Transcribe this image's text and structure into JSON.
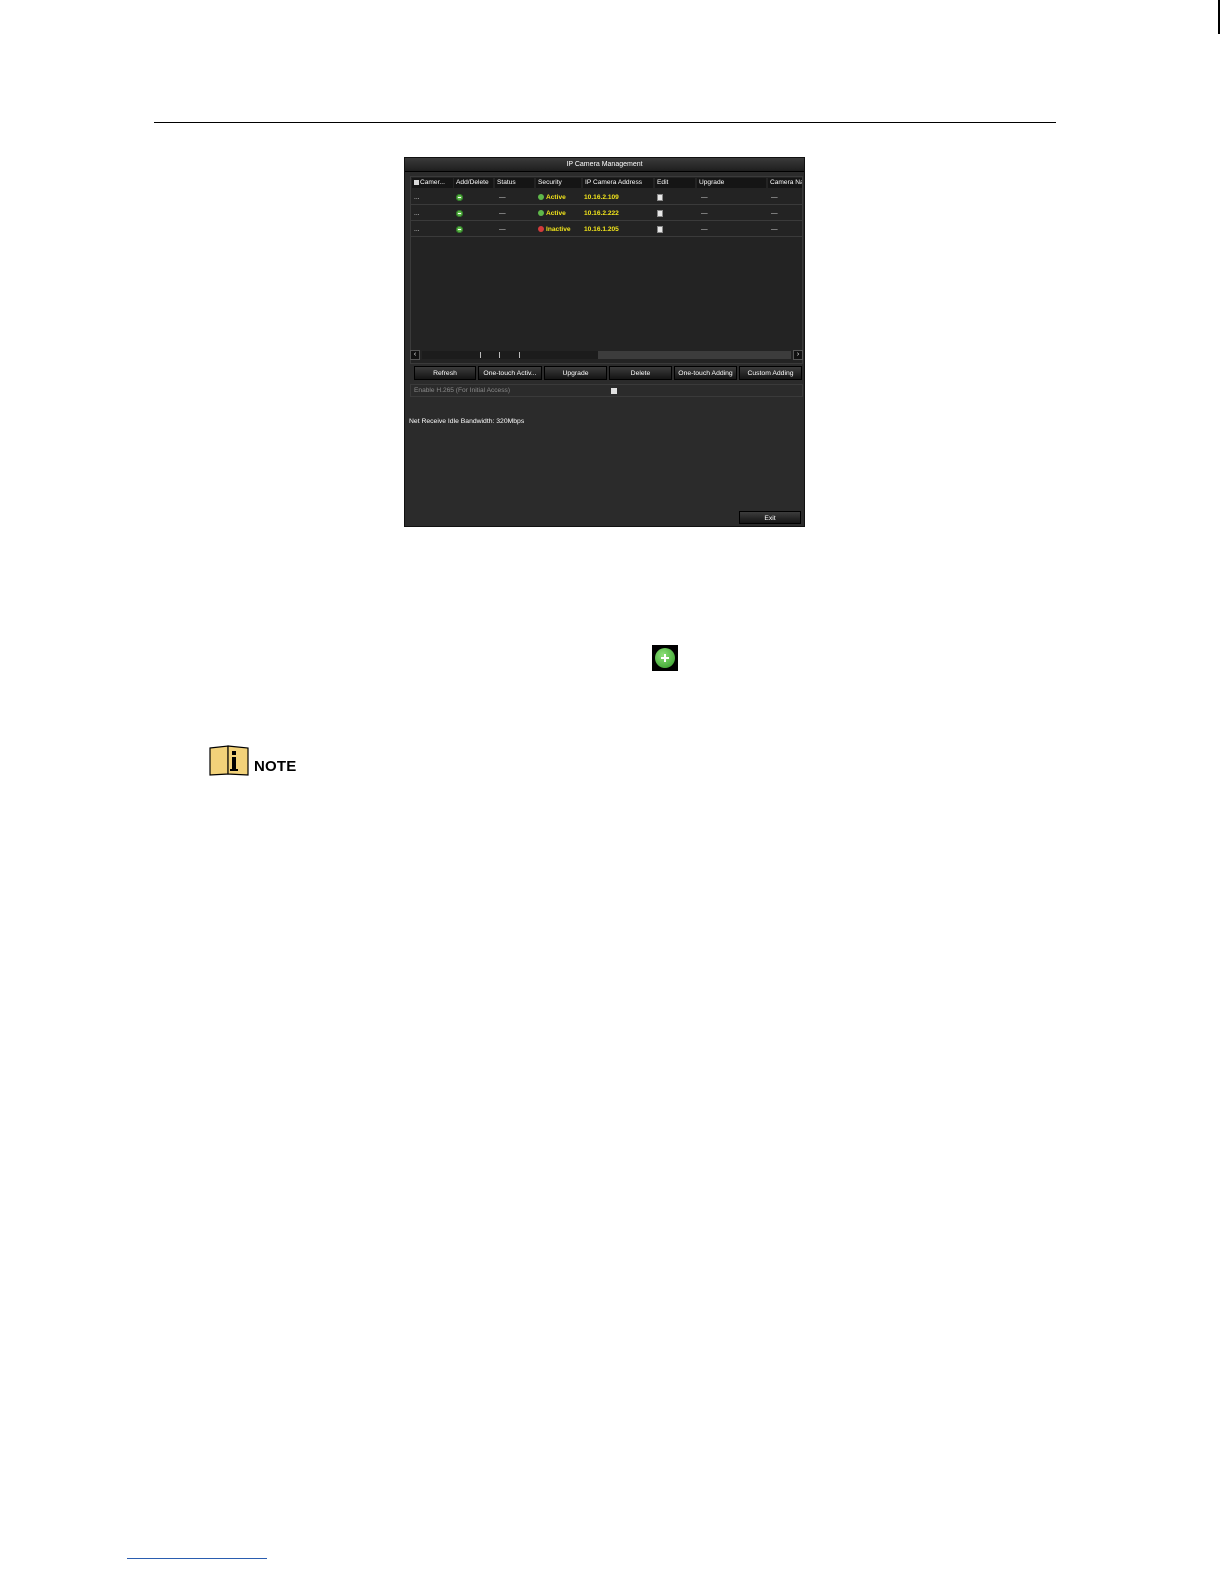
{
  "dialog": {
    "title": "IP Camera Management",
    "columns": [
      "Camer...",
      "Add/Delete",
      "Status",
      "Security",
      "IP Camera Address",
      "Edit",
      "Upgrade",
      "Camera Na"
    ],
    "rows": [
      {
        "camera": "...",
        "status": "—",
        "security": "Active",
        "security_state": "ok",
        "ip": "10.16.2.109",
        "upgrade": "—",
        "camera_name": "—"
      },
      {
        "camera": "...",
        "status": "—",
        "security": "Active",
        "security_state": "ok",
        "ip": "10.16.2.222",
        "upgrade": "—",
        "camera_name": "—"
      },
      {
        "camera": "...",
        "status": "—",
        "security": "Inactive",
        "security_state": "bad",
        "ip": "10.16.1.205",
        "upgrade": "—",
        "camera_name": "—"
      }
    ],
    "buttons": {
      "refresh": "Refresh",
      "one_touch_activate": "One-touch Activ...",
      "upgrade": "Upgrade",
      "delete": "Delete",
      "one_touch_adding": "One-touch Adding",
      "custom_adding": "Custom Adding"
    },
    "h265_label": "Enable H.265 (For Initial Access)",
    "bandwidth": "Net Receive Idle Bandwidth: 320Mbps",
    "exit": "Exit"
  },
  "note": {
    "label": "NOTE"
  },
  "colors": {
    "accent_yellow": "#f2e51b",
    "add_green": "#5fb84a",
    "inactive_red": "#d33b3b"
  }
}
